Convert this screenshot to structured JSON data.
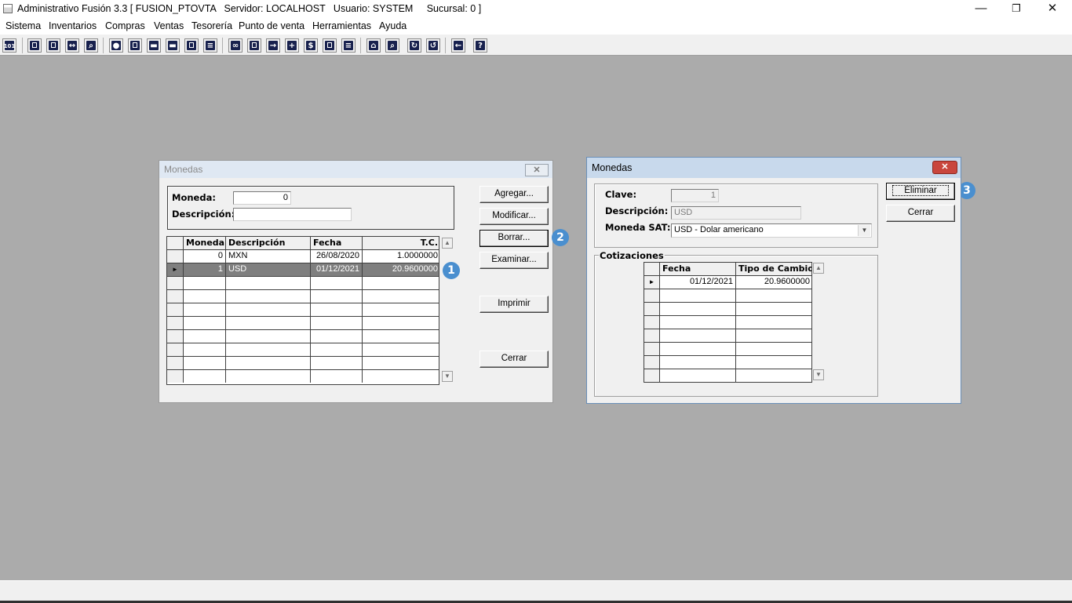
{
  "window": {
    "title": "Administrativo Fusión 3.3 [ FUSION_PTOVTA   Servidor: LOCALHOST   Usuario: SYSTEM     Sucursal: 0 ]",
    "minimize": "—",
    "restore": "❐",
    "close": "✕"
  },
  "menu": [
    "Sistema",
    "Inventarios",
    "Compras",
    "Ventas",
    "Tesorería",
    "Punto de venta",
    "Herramientas",
    "Ayuda"
  ],
  "toolbar_icons": [
    "calculator-icon",
    "copy-icon",
    "clipboard-icon",
    "transfer-icon",
    "find-icon",
    "user-icon",
    "folder-icon",
    "print-icon",
    "print-preview-icon",
    "document-icon",
    "list-icon",
    "binoculars-icon",
    "window-icon",
    "export-icon",
    "add-icon",
    "currency-icon",
    "report-icon",
    "table-icon",
    "home-icon",
    "zoom-icon",
    "refresh-icon",
    "undo-icon",
    "back-icon",
    "help-icon"
  ],
  "monedas_list": {
    "title": "Monedas",
    "close": "✕",
    "filter": {
      "moneda_label": "Moneda:",
      "moneda_value": "0",
      "descripcion_label": "Descripción:",
      "descripcion_value": ""
    },
    "grid": {
      "columns": [
        "Moneda",
        "Descripción",
        "Fecha",
        "T.C."
      ],
      "rows": [
        {
          "moneda": "0",
          "descripcion": "MXN",
          "fecha": "26/08/2020",
          "tc": "1.0000000"
        },
        {
          "moneda": "1",
          "descripcion": "USD",
          "fecha": "01/12/2021",
          "tc": "20.9600000"
        }
      ],
      "selected_indicator": "►"
    },
    "buttons": {
      "agregar": "Agregar...",
      "modificar": "Modificar...",
      "borrar": "Borrar...",
      "examinar": "Examinar...",
      "imprimir": "Imprimir",
      "cerrar": "Cerrar"
    },
    "scroll_up": "▲",
    "scroll_down": "▼"
  },
  "monedas_detail": {
    "title": "Monedas",
    "close": "✕",
    "clave_label": "Clave:",
    "clave_value": "1",
    "descripcion_label": "Descripción:",
    "descripcion_value": "USD",
    "moneda_sat_label": "Moneda SAT:",
    "moneda_sat_value": "USD - Dolar americano",
    "combo_arrow": "▼",
    "cotizaciones_label": "Cotizaciones",
    "grid": {
      "columns": [
        "Fecha",
        "Tipo de Cambio"
      ],
      "rows": [
        {
          "fecha": "01/12/2021",
          "tipo": "20.9600000"
        }
      ],
      "selected_indicator": "►"
    },
    "buttons": {
      "eliminar": "Eliminar",
      "cerrar": "Cerrar"
    },
    "scroll_up": "▲",
    "scroll_down": "▼"
  },
  "badges": [
    "1",
    "2",
    "3"
  ],
  "colors": {
    "badge": "#4a8fcf",
    "selected_row": "#7f7f7f",
    "desktop": "#ababab"
  }
}
